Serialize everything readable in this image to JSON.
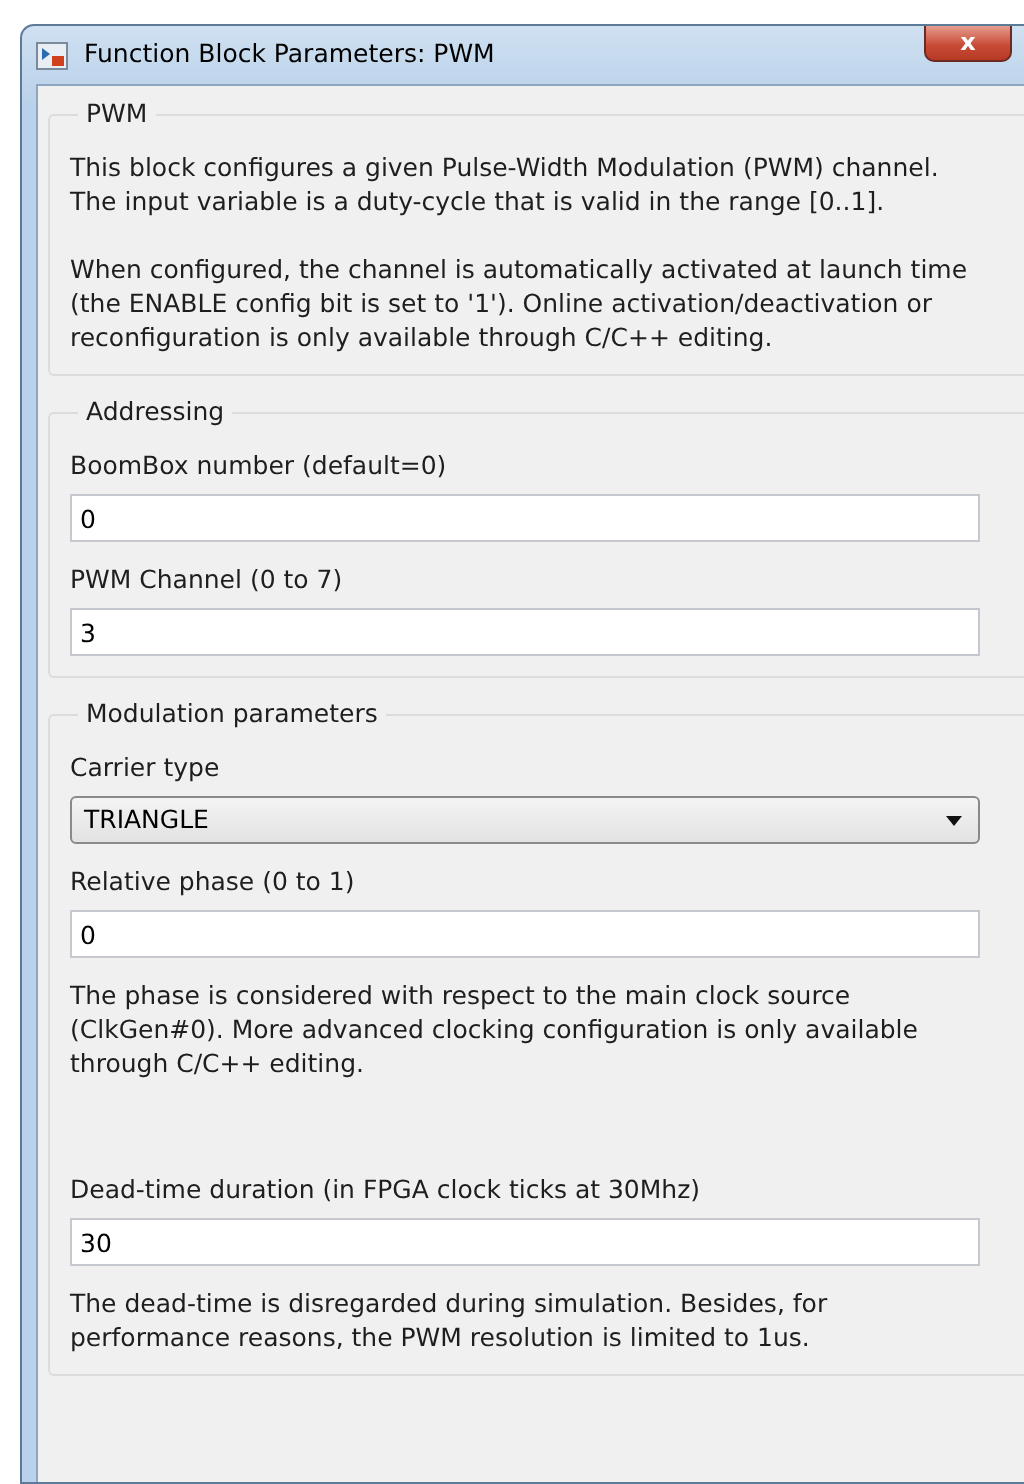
{
  "window": {
    "title": "Function Block Parameters: PWM",
    "close": "x"
  },
  "groups": [
    {
      "title": "PWM",
      "items": [
        {
          "kind": "note",
          "text": "This block configures a given Pulse-Width Modulation (PWM) channel. The input variable is a duty-cycle that is valid in the range [0..1]."
        },
        {
          "kind": "note",
          "text": "When configured, the channel is automatically activated at launch time (the ENABLE config bit is set to '1'). Online activation/deactivation or reconfiguration is only available through C/C++ editing."
        }
      ]
    },
    {
      "title": "Addressing",
      "items": [
        {
          "kind": "label",
          "text": "BoomBox number (default=0)"
        },
        {
          "kind": "field",
          "value": "0"
        },
        {
          "kind": "label",
          "text": "PWM Channel (0 to 7)"
        },
        {
          "kind": "field",
          "value": "3"
        }
      ]
    },
    {
      "title": "Modulation parameters",
      "items": [
        {
          "kind": "label",
          "text": "Carrier type"
        },
        {
          "kind": "dropdown",
          "value": "TRIANGLE"
        },
        {
          "kind": "label",
          "text": "Relative phase (0 to 1)"
        },
        {
          "kind": "field",
          "value": "0"
        },
        {
          "kind": "note",
          "text": "The phase is considered with respect to the main clock source (ClkGen#0). More advanced clocking configuration is only available through C/C++ editing."
        },
        {
          "kind": "label",
          "text": "Dead-time duration (in FPGA clock ticks at 30Mhz)"
        },
        {
          "kind": "field",
          "value": "30"
        },
        {
          "kind": "note",
          "text": "The dead-time is disregarded during simulation. Besides, for performance reasons, the PWM resolution is limited to 1us."
        }
      ]
    }
  ]
}
